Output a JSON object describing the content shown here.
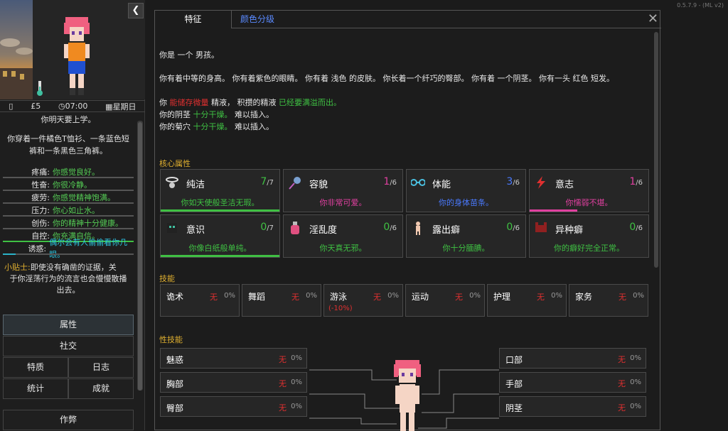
{
  "version": "0.5.7.9 - (ML v2)",
  "sidebar": {
    "collapse_icon": "chevron-left-icon",
    "stats": {
      "money": "£5",
      "time": "07:00",
      "day": "星期日"
    },
    "school_notice": "你明天要上学。",
    "clothing_line1": "你穿着一件橘色T恤衫、一条蓝色短",
    "clothing_line2": "裤和一条黑色三角裤。",
    "states": [
      {
        "label": "疼痛:",
        "value": "你感觉良好。",
        "color": "#55cc55"
      },
      {
        "label": "性奋:",
        "value": "你很冷静。",
        "color": "#55cc55"
      },
      {
        "label": "疲劳:",
        "value": "你感觉精神饱满。",
        "color": "#55cc55"
      },
      {
        "label": "压力:",
        "value": "你心如止水。",
        "color": "#55cc55"
      },
      {
        "label": "创伤:",
        "value": "你的精神十分健康。",
        "color": "#55cc55"
      },
      {
        "label": "自控:",
        "value": "你充满自信。",
        "color": "#55cc55",
        "fill": 1.0,
        "fill_color": "#3fc043"
      },
      {
        "label": "诱惑:",
        "value": "偶尔会有人偷偷看你几眼。",
        "color": "#2bc4e0",
        "fill": 0.1,
        "fill_color": "#2bb3c9"
      }
    ],
    "tip_label": "小贴士:",
    "tip_line1": "即使没有确凿的证据，关",
    "tip_line2": "于你淫荡行为的流言也会慢慢散播",
    "tip_line3": "出去。",
    "nav": {
      "attributes": "属性",
      "social": "社交",
      "traits": "特质",
      "journal": "日志",
      "stats": "统计",
      "achievements": "成就",
      "cheats": "作弊"
    }
  },
  "main": {
    "tabs": [
      "特征",
      "颜色分级"
    ],
    "desc": {
      "gender": "你是 一个 男孩。",
      "body": "你有着中等的身高。 你有着紫色的眼睛。 你有着 浅色 的皮肤。 你长着一个纤巧的臀部。 你有着 一个阴茎。 你有一头 红色 短发。",
      "semen_prefix": "你 ",
      "semen_red": "能储存微量",
      "semen_mid": " 精液， 积攒的精液 ",
      "semen_green": "已经要满溢而出。",
      "semen_end": "",
      "penis_prefix": "你的阴茎 ",
      "penis_green": "十分干燥。",
      "penis_end": " 难以插入。",
      "anus_prefix": "你的菊穴 ",
      "anus_green": "十分干燥。",
      "anus_end": " 难以插入。"
    },
    "core_title": "核心属性",
    "core": [
      {
        "name": "纯洁",
        "value": 7,
        "max": "/7",
        "color": "#3fc043",
        "desc": "你如天使般圣洁无瑕。",
        "desc_color": "#3fc043",
        "fill": 1.0,
        "icon": "halo-icon"
      },
      {
        "name": "容貌",
        "value": 1,
        "max": "/6",
        "color": "#e040a0",
        "desc": "你非常可爱。",
        "desc_color": "#e040a0",
        "fill": 0,
        "icon": "mirror-icon"
      },
      {
        "name": "体能",
        "value": 3,
        "max": "/6",
        "color": "#4a7aff",
        "desc": "你的身体苗条。",
        "desc_color": "#4a7aff",
        "fill": 0,
        "icon": "dumbbell-icon"
      },
      {
        "name": "意志",
        "value": 1,
        "max": "/6",
        "color": "#e040a0",
        "desc": "你懦弱不堪。",
        "desc_color": "#e040a0",
        "fill": 0.4,
        "icon": "lightning-icon"
      },
      {
        "name": "意识",
        "value": 0,
        "max": "/7",
        "color": "#3fc043",
        "desc": "你像白纸般单纯。",
        "desc_color": "#3fc043",
        "fill": 1.0,
        "icon": "head-icon"
      },
      {
        "name": "淫乱度",
        "value": 0,
        "max": "/6",
        "color": "#3fc043",
        "desc": "你天真无邪。",
        "desc_color": "#3fc043",
        "fill": 0,
        "icon": "potion-icon"
      },
      {
        "name": "露出癖",
        "value": 0,
        "max": "/6",
        "color": "#3fc043",
        "desc": "你十分腼腆。",
        "desc_color": "#3fc043",
        "fill": 0,
        "icon": "figure-icon"
      },
      {
        "name": "异种癖",
        "value": 0,
        "max": "/6",
        "color": "#3fc043",
        "desc": "你的癖好完全正常。",
        "desc_color": "#3fc043",
        "fill": 0,
        "icon": "beast-icon"
      }
    ],
    "skills_title": "技能",
    "skills": [
      {
        "name": "诡术",
        "level": "无",
        "pct": "0%"
      },
      {
        "name": "舞蹈",
        "level": "无",
        "pct": "0%"
      },
      {
        "name": "游泳",
        "level": "无",
        "pct": "0%",
        "mod": "(-10%)"
      },
      {
        "name": "运动",
        "level": "无",
        "pct": "0%"
      },
      {
        "name": "护理",
        "level": "无",
        "pct": "0%"
      },
      {
        "name": "家务",
        "level": "无",
        "pct": "0%"
      }
    ],
    "sex_title": "性技能",
    "sex_left": [
      {
        "name": "魅惑",
        "level": "无",
        "pct": "0%"
      },
      {
        "name": "胸部",
        "level": "无",
        "pct": "0%"
      },
      {
        "name": "臀部",
        "level": "无",
        "pct": "0%"
      }
    ],
    "sex_right": [
      {
        "name": "口部",
        "level": "无",
        "pct": "0%"
      },
      {
        "name": "手部",
        "level": "无",
        "pct": "0%"
      },
      {
        "name": "阴茎",
        "level": "无",
        "pct": "0%"
      }
    ]
  }
}
